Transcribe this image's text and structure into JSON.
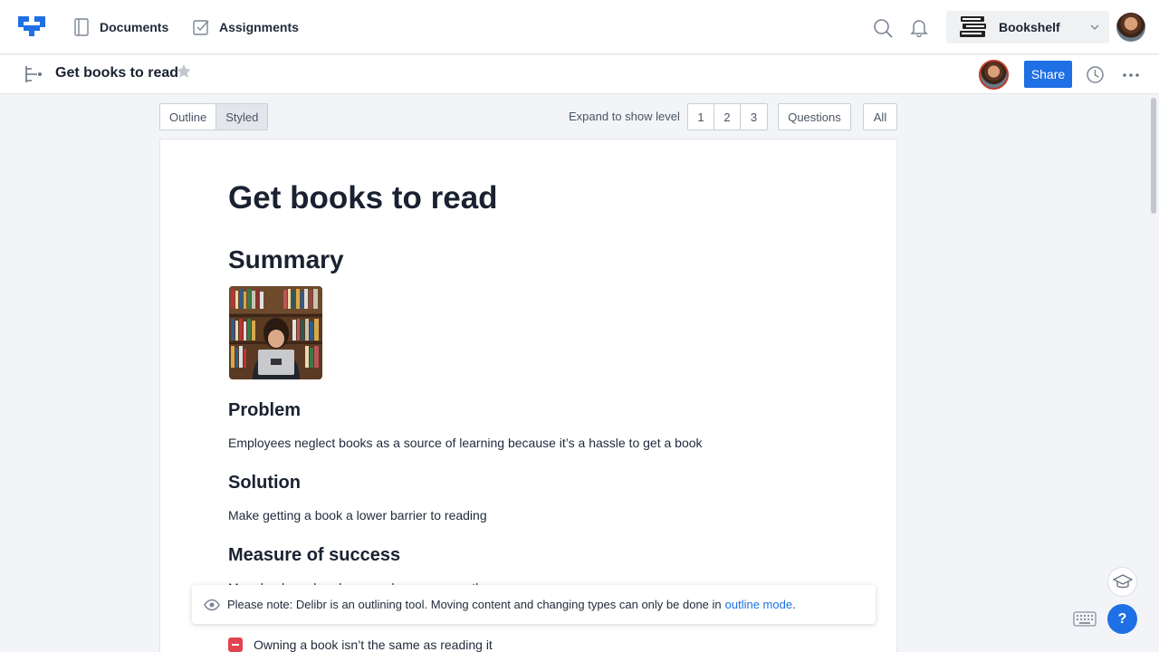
{
  "nav": {
    "documents_label": "Documents",
    "assignments_label": "Assignments",
    "workspace_name": "Bookshelf"
  },
  "doc_header": {
    "title": "Get books to read",
    "share_label": "Share"
  },
  "toolbar": {
    "view_modes": [
      "Outline",
      "Styled"
    ],
    "active_view": "Styled",
    "expand_label": "Expand to show level",
    "levels": [
      "1",
      "2",
      "3"
    ],
    "questions_label": "Questions",
    "all_label": "All"
  },
  "document": {
    "title": "Get books to read",
    "summary_heading": "Summary",
    "problem_heading": "Problem",
    "problem_text": "Employees neglect books as a source of learning because it’s a hassle to get a book",
    "solution_heading": "Solution",
    "solution_text": "Make getting a book a lower barrier to reading",
    "success_heading": "Measure of success",
    "success_text": "More books ordered per employee per month",
    "con_item": "Owning a book isn’t the same as reading it"
  },
  "notice": {
    "text": "Please note: Delibr is an outlining tool. Moving content and changing types can only be done in",
    "link": "outline mode",
    "suffix": "."
  },
  "help_label": "?",
  "colors": {
    "brand_blue": "#1f6fe5",
    "con_red": "#e0444f",
    "collab_ring": "#c0392b"
  }
}
